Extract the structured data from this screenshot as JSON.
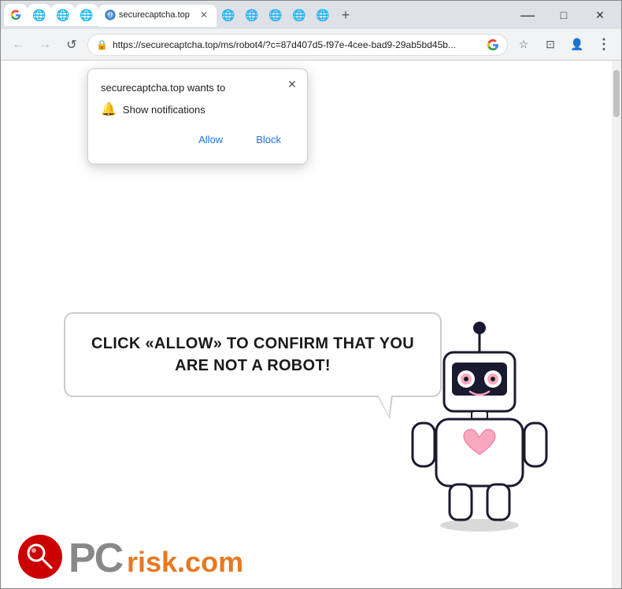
{
  "browser": {
    "tabs": [
      {
        "id": "tab1",
        "favicon_color": "#4285f4",
        "favicon_label": "G",
        "title": "securecaptcha.top",
        "active": true
      },
      {
        "id": "tab2",
        "favicon": "globe",
        "title": ""
      },
      {
        "id": "tab3",
        "favicon": "globe",
        "title": ""
      },
      {
        "id": "tab4",
        "favicon": "globe",
        "title": ""
      },
      {
        "id": "tab5",
        "favicon": "star",
        "title": ""
      },
      {
        "id": "tab6",
        "favicon": "globe",
        "title": ""
      },
      {
        "id": "tab7",
        "favicon": "globe",
        "title": ""
      },
      {
        "id": "tab8",
        "favicon": "globe",
        "title": ""
      },
      {
        "id": "tab9",
        "favicon": "globe",
        "title": ""
      },
      {
        "id": "tab10",
        "favicon": "globe",
        "title": ""
      }
    ],
    "new_tab_label": "+",
    "window_controls": {
      "minimize": "—",
      "maximize": "□",
      "close": "✕"
    },
    "nav": {
      "back": "←",
      "forward": "→",
      "reload": "↺",
      "lock_icon": "🔒",
      "url": "https://securecaptcha.top/ms/robot4/?c=87d407d5-f97e-4cee-bad9-29ab5bd45b...",
      "url_short": "https://securecaptcha.top/ms/robot4/?c=87d407d5-f97e-4cee-bad9-29ab5bd45b...",
      "bookmark_icon": "☆",
      "tab_icon": "⊡",
      "profile_icon": "👤",
      "menu_icon": "⋮"
    }
  },
  "notification_popup": {
    "title": "securecaptcha.top wants to",
    "close_btn": "✕",
    "notification_icon": "🔔",
    "notification_text": "Show notifications",
    "allow_btn": "Allow",
    "block_btn": "Block"
  },
  "page": {
    "speech_bubble_text": "CLICK «ALLOW» TO CONFIRM THAT YOU ARE NOT A ROBOT!",
    "robot_alt": "Robot illustration"
  },
  "pcrisk": {
    "logo_alt": "PCRisk.com logo",
    "text": "risk.com"
  }
}
